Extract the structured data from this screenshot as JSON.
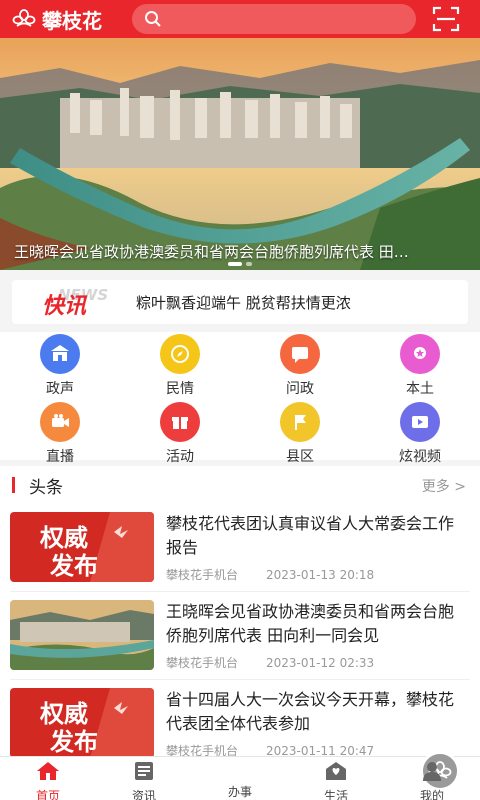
{
  "header": {
    "brand": "攀枝花",
    "search_placeholder": "",
    "accent_color": "#e8262b"
  },
  "banner": {
    "caption": "王晓晖会见省政协港澳委员和省两会台胞侨胞列席代表 田…",
    "slide_count": 2,
    "active_slide": 1
  },
  "ticker": {
    "logo_text": "快讯",
    "logo_bg_text": "NEWS",
    "text": "粽叶飘香迎端午 脱贫帮扶情更浓"
  },
  "grid": [
    {
      "label": "政声",
      "icon": "government-icon",
      "color": "#4c7bf0"
    },
    {
      "label": "民情",
      "icon": "compass-icon",
      "color": "#f5c518"
    },
    {
      "label": "问政",
      "icon": "chat-icon",
      "color": "#f5673f"
    },
    {
      "label": "本土",
      "icon": "badge-icon",
      "color": "#e95bd1"
    },
    {
      "label": "直播",
      "icon": "camera-icon",
      "color": "#f58a3f"
    },
    {
      "label": "活动",
      "icon": "gift-icon",
      "color": "#ee3d3d"
    },
    {
      "label": "县区",
      "icon": "flag-icon",
      "color": "#f2c52a"
    },
    {
      "label": "炫视频",
      "icon": "video-icon",
      "color": "#6d6ee8"
    }
  ],
  "section": {
    "title": "头条",
    "more": "更多 >"
  },
  "news": [
    {
      "title": "攀枝花代表团认真审议省人大常委会工作报告",
      "source": "攀枝花手机台",
      "date": "2023-01-13 20:18",
      "thumb": "authority",
      "thumb_text_1": "权威",
      "thumb_text_2": "发布"
    },
    {
      "title": "王晓晖会见省政协港澳委员和省两会台胞侨胞列席代表 田向利一同会见",
      "source": "攀枝花手机台",
      "date": "2023-01-12 02:33",
      "thumb": "city",
      "thumb_text_1": "",
      "thumb_text_2": ""
    },
    {
      "title": "省十四届人大一次会议今天开幕，攀枝花代表团全体代表参加",
      "source": "攀枝花手机台",
      "date": "2023-01-11 20:47",
      "thumb": "authority",
      "thumb_text_1": "权威",
      "thumb_text_2": "发布"
    }
  ],
  "nav": [
    {
      "label": "首页",
      "icon": "home-icon",
      "active": true
    },
    {
      "label": "资讯",
      "icon": "news-icon",
      "active": false
    },
    {
      "label": "办事",
      "icon": "flower-icon",
      "active": false
    },
    {
      "label": "生活",
      "icon": "life-icon",
      "active": false
    },
    {
      "label": "我的",
      "icon": "user-icon",
      "active": false
    }
  ]
}
